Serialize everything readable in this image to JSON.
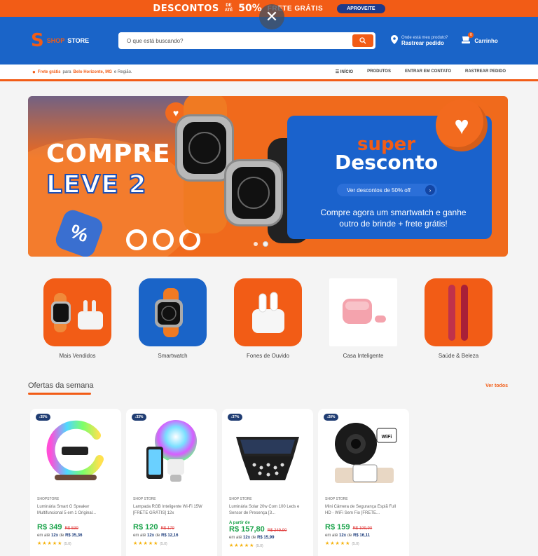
{
  "promo": {
    "text_left": "DESCONTOS",
    "de_ate_top": "DE",
    "de_ate_bottom": "ATÉ",
    "percent": "50%",
    "text_right": "FRETE GRÁTIS",
    "cta": "APROVEITE"
  },
  "header": {
    "logo_mark": "S",
    "logo_shop": "SHOP",
    "logo_store": "STORE",
    "search_placeholder": "O que está buscando?",
    "track_small": "Onde está meu produto?",
    "track_big": "Rastrear pedido",
    "cart_label": "Carrinho",
    "cart_count": "0"
  },
  "nav": {
    "shipping_prefix": "Frete grátis",
    "shipping_mid": "para",
    "shipping_city": "Belo Horizonte, MG",
    "shipping_suffix": "e Região.",
    "links": [
      "INÍCIO",
      "PRODUTOS",
      "ENTRAR EM CONTATO",
      "RASTREAR PEDIDO"
    ]
  },
  "hero": {
    "line1": "COMPRE 1",
    "line2": "LEVE 2",
    "super": "super",
    "desconto": "Desconto",
    "button": "Ver descontos de 50% off",
    "subtitle": "Compre agora um smartwatch e ganhe outro de brinde + frete grátis!"
  },
  "categories": [
    {
      "label": "Mais Vendidos",
      "style": "orange"
    },
    {
      "label": "Smartwatch",
      "style": "blue"
    },
    {
      "label": "Fones de Ouvido",
      "style": "orange"
    },
    {
      "label": "Casa Inteligente",
      "style": "white"
    },
    {
      "label": "Saúde & Beleza",
      "style": "orange"
    }
  ],
  "offers": {
    "title": "Ofertas da semana",
    "see_all": "Ver todos"
  },
  "products": [
    {
      "discount": "↓35%",
      "brand": "SHOPSTORE",
      "name": "Luminária Smart G Speaker Multifuncional 5 em 1 Original...",
      "from": "",
      "price": "R$ 349",
      "old_price": "R$ 539",
      "inst_prefix": "em até",
      "inst_times": "12x",
      "inst_mid": "de",
      "inst_value": "R$ 35,36",
      "stars": "★★★★★",
      "score": "(5.0)"
    },
    {
      "discount": "↓33%",
      "brand": "SHOP STORE",
      "name": "Lampada RGB Inteligente Wi-Fi 15W [FRETE GRÁTIS] 12x",
      "from": "",
      "price": "R$ 120",
      "old_price": "R$ 179",
      "inst_prefix": "em até",
      "inst_times": "12x",
      "inst_mid": "de",
      "inst_value": "R$ 12,16",
      "stars": "★★★★★",
      "score": "(5.0)"
    },
    {
      "discount": "↓37%",
      "brand": "SHOP STORE",
      "name": "Luminária Solar 20w Com 100 Leds e Sensor de Presença [3...",
      "from": "A partir de",
      "price": "R$ 157,80",
      "old_price": "R$ 249,90",
      "inst_prefix": "em até",
      "inst_times": "12x",
      "inst_mid": "de",
      "inst_value": "R$ 15,99",
      "stars": "★★★★★",
      "score": "(5.0)"
    },
    {
      "discount": "↓20%",
      "brand": "SHOP STORE",
      "name": "Mini Câmera de Segurança Espiã Full HD - WiFi Sem Fio [FRETE...",
      "from": "",
      "price": "R$ 159",
      "old_price": "R$ 199,90",
      "inst_prefix": "em até",
      "inst_times": "12x",
      "inst_mid": "de",
      "inst_value": "R$ 16,11",
      "stars": "★★★★★",
      "score": "(5.0)"
    }
  ]
}
